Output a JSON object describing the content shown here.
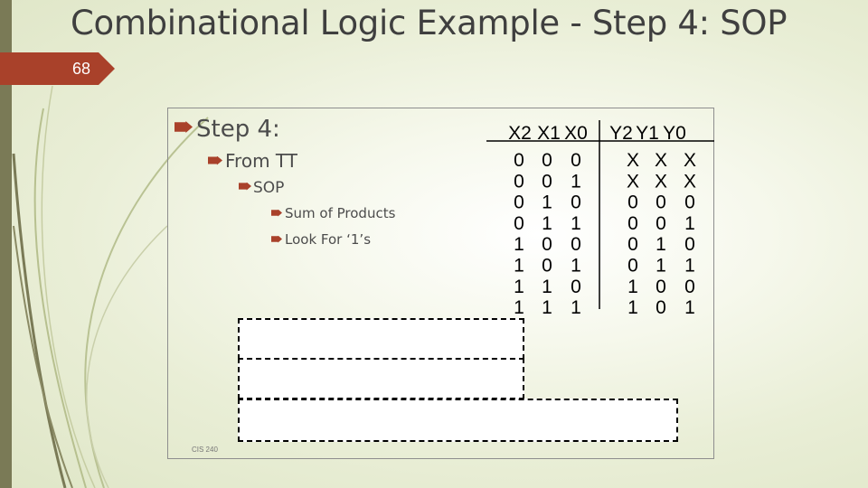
{
  "slide": {
    "title": "Combinational Logic Example - Step 4: SOP",
    "page_number": "68",
    "footer": "CIS 240"
  },
  "bullets": {
    "step": "Step 4:",
    "from_tt": "From TT",
    "sop": "SOP",
    "sum_of_products": "Sum of Products",
    "look_for": "Look For ‘1’s"
  },
  "truth_table": {
    "input_header": [
      "X2",
      "X1",
      "X0"
    ],
    "output_header": [
      "Y2",
      "Y1",
      "Y0"
    ],
    "rows": [
      {
        "inputs": [
          "0",
          "0",
          "0"
        ],
        "outputs": [
          "X",
          "X",
          "X"
        ]
      },
      {
        "inputs": [
          "0",
          "0",
          "1"
        ],
        "outputs": [
          "X",
          "X",
          "X"
        ]
      },
      {
        "inputs": [
          "0",
          "1",
          "0"
        ],
        "outputs": [
          "0",
          "0",
          "0"
        ]
      },
      {
        "inputs": [
          "0",
          "1",
          "1"
        ],
        "outputs": [
          "0",
          "0",
          "1"
        ]
      },
      {
        "inputs": [
          "1",
          "0",
          "0"
        ],
        "outputs": [
          "0",
          "1",
          "0"
        ]
      },
      {
        "inputs": [
          "1",
          "0",
          "1"
        ],
        "outputs": [
          "0",
          "1",
          "1"
        ]
      },
      {
        "inputs": [
          "1",
          "1",
          "0"
        ],
        "outputs": [
          "1",
          "0",
          "0"
        ]
      },
      {
        "inputs": [
          "1",
          "1",
          "1"
        ],
        "outputs": [
          "1",
          "0",
          "1"
        ]
      }
    ]
  },
  "colors": {
    "accent": "#a9412a",
    "title_text": "#3f3f3f",
    "left_bar": "#7a7a56"
  }
}
